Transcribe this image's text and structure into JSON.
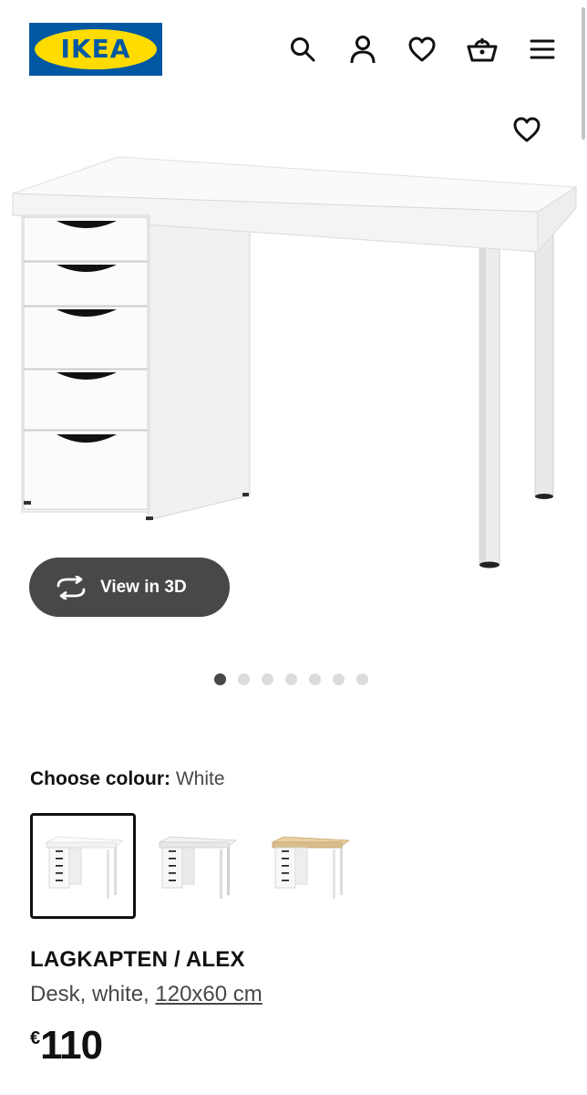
{
  "header": {
    "logo_text": "IKEA",
    "icons": [
      "search-icon",
      "account-icon",
      "heart-icon",
      "basket-icon",
      "menu-icon"
    ]
  },
  "colors": {
    "ikea_blue": "#0058A3",
    "ikea_yellow": "#FFDB00",
    "pill_bg": "#484848"
  },
  "product": {
    "view3d_label": "View in 3D",
    "carousel": {
      "total": 7,
      "active": 1
    },
    "colour": {
      "label": "Choose colour:",
      "value": "White",
      "selected_index": 0
    },
    "swatches": [
      "White",
      "White",
      "Oak"
    ],
    "name": "LAGKAPTEN / ALEX",
    "description_prefix": "Desk, white, ",
    "size": "120x60 cm",
    "price_currency": "€",
    "price_amount": "110"
  }
}
